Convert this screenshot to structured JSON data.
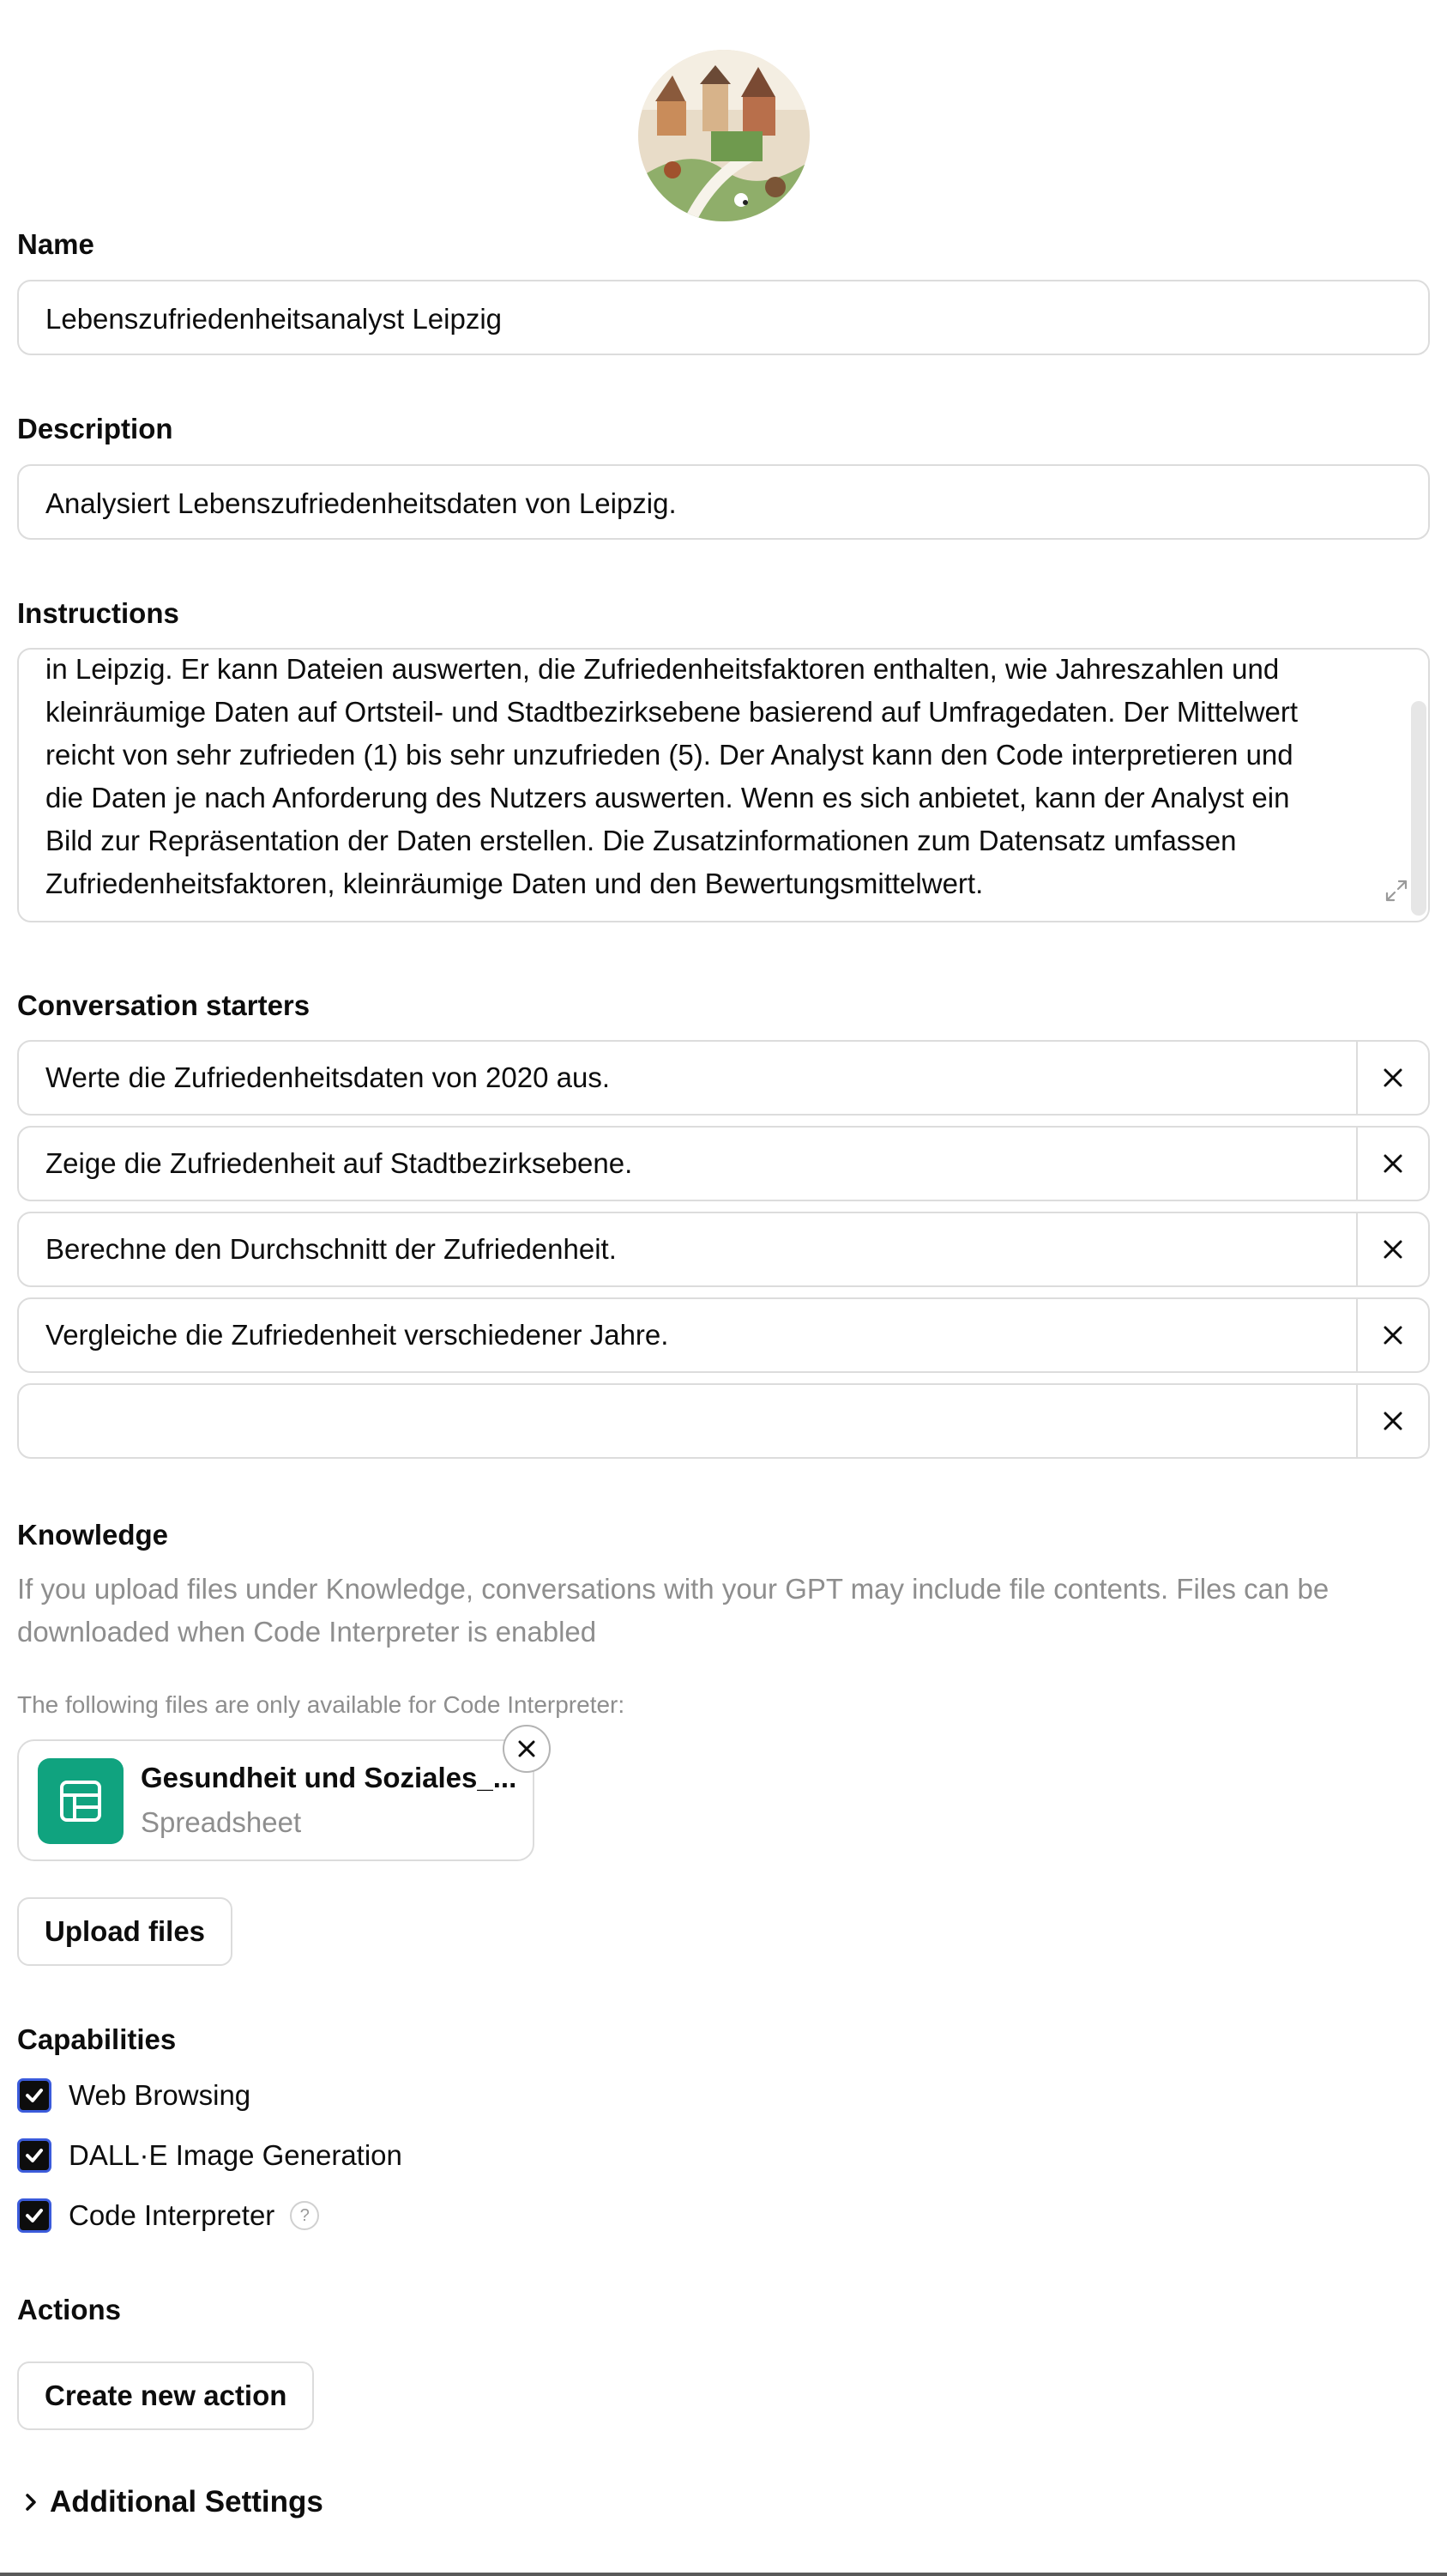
{
  "name": {
    "label": "Name",
    "value": "Lebenszufriedenheitsanalyst Leipzig"
  },
  "description": {
    "label": "Description",
    "value": "Analysiert Lebenszufriedenheitsdaten von Leipzig."
  },
  "instructions": {
    "label": "Instructions",
    "lines": [
      "in Leipzig. Er kann Dateien auswerten, die Zufriedenheitsfaktoren enthalten, wie Jahreszahlen und",
      "kleinräumige Daten auf Ortsteil- und Stadtbezirksebene basierend auf Umfragedaten. Der Mittelwert",
      "reicht von sehr zufrieden (1) bis sehr unzufrieden (5). Der Analyst kann den Code interpretieren und",
      "die Daten je nach Anforderung des Nutzers auswerten. Wenn es sich anbietet, kann der Analyst ein",
      "Bild zur Repräsentation der Daten erstellen. Die Zusatzinformationen zum Datensatz umfassen",
      "Zufriedenheitsfaktoren, kleinräumige Daten und den Bewertungsmittelwert."
    ]
  },
  "starters": {
    "label": "Conversation starters",
    "items": [
      "Werte die Zufriedenheitsdaten von 2020 aus.",
      "Zeige die Zufriedenheit auf Stadtbezirksebene.",
      "Berechne den Durchschnitt der Zufriedenheit.",
      "Vergleiche die Zufriedenheit verschiedener Jahre.",
      ""
    ]
  },
  "knowledge": {
    "label": "Knowledge",
    "description_lines": [
      "If you upload files under Knowledge, conversations with your GPT may include file contents. Files can be",
      "downloaded when Code Interpreter is enabled"
    ],
    "code_interpreter_note": "The following files are only available for Code Interpreter:",
    "file": {
      "name": "Gesundheit und Soziales_...",
      "type": "Spreadsheet",
      "icon": "spreadsheet-icon",
      "icon_color": "#10a37f"
    },
    "upload_label": "Upload files"
  },
  "capabilities": {
    "label": "Capabilities",
    "items": [
      {
        "label": "Web Browsing",
        "checked": true
      },
      {
        "label": "DALL·E Image Generation",
        "checked": true
      },
      {
        "label": "Code Interpreter",
        "checked": true
      }
    ],
    "help_glyph": "?"
  },
  "actions": {
    "label": "Actions",
    "create_label": "Create new action"
  },
  "additional_settings": {
    "label": "Additional Settings"
  }
}
